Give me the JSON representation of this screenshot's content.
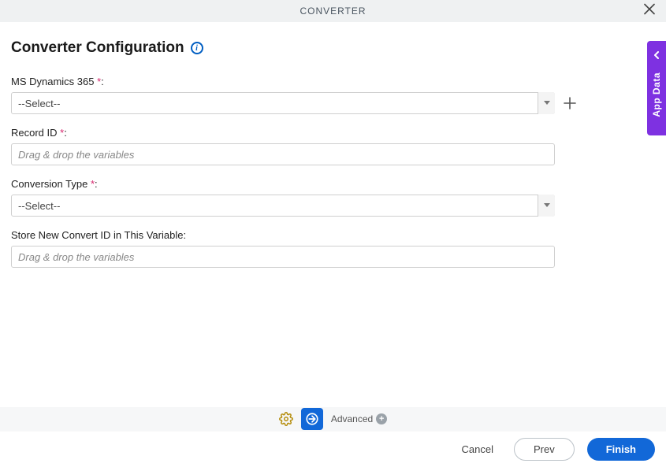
{
  "header": {
    "title": "CONVERTER"
  },
  "page": {
    "title": "Converter Configuration"
  },
  "fields": {
    "dynamics": {
      "label": "MS Dynamics 365 ",
      "value": "--Select--"
    },
    "record_id": {
      "label": "Record ID ",
      "placeholder": "Drag & drop the variables"
    },
    "conv_type": {
      "label": "Conversion Type ",
      "value": "--Select--"
    },
    "store_var": {
      "label": "Store New Convert ID in This Variable:",
      "placeholder": "Drag & drop the variables"
    }
  },
  "required": "*",
  "colon": ":",
  "side_tab": {
    "label": "App Data"
  },
  "toolbar": {
    "advanced": "Advanced"
  },
  "footer": {
    "cancel": "Cancel",
    "prev": "Prev",
    "finish": "Finish"
  }
}
